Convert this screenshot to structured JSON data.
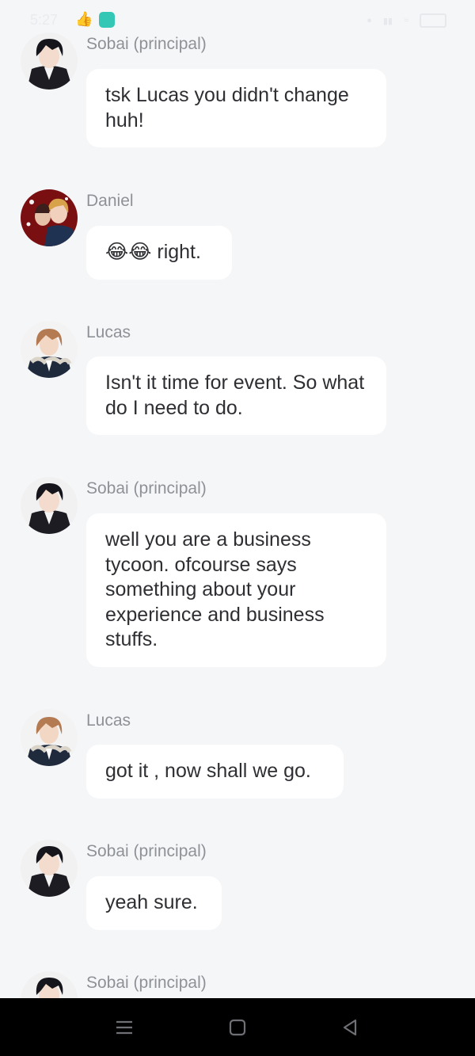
{
  "status_bar": {
    "time": "5:27",
    "colors": {
      "overlay_text": "#e9ebef",
      "app_badge": "#34c7b5"
    },
    "icons": [
      "like-icon",
      "app-badge-icon",
      "data-speed-icon",
      "signal-icon",
      "wifi-icon",
      "battery-icon"
    ]
  },
  "messages": [
    {
      "sender": "Sobai (principal)",
      "text": "tsk Lucas you didn't change huh!",
      "avatar": "sobai-avatar"
    },
    {
      "sender": "Daniel",
      "text": "😂😂 right.",
      "avatar": "daniel-avatar"
    },
    {
      "sender": "Lucas",
      "text": "Isn't it time for event. So what do I need to do.",
      "avatar": "lucas-avatar"
    },
    {
      "sender": "Sobai (principal)",
      "text": "well you are a business tycoon. ofcourse says something about your experience and business stuffs.",
      "avatar": "sobai-avatar"
    },
    {
      "sender": "Lucas",
      "text": "got it , now shall we go.",
      "avatar": "lucas-avatar"
    },
    {
      "sender": "Sobai (principal)",
      "text": "yeah sure.",
      "avatar": "sobai-avatar"
    },
    {
      "sender": "Sobai (principal)",
      "text": "",
      "avatar": "sobai-avatar"
    }
  ],
  "nav_bar": {
    "icons": [
      "menu-icon",
      "home-icon",
      "back-icon"
    ]
  },
  "colors": {
    "background": "#f5f6f8",
    "bubble": "#ffffff",
    "sender_text": "#8e9196",
    "message_text": "#2e2f33"
  }
}
